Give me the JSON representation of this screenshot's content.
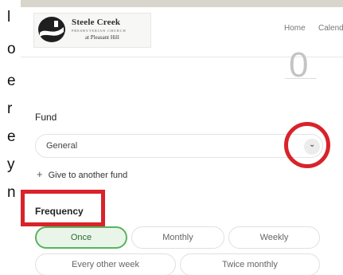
{
  "left_text": [
    "l",
    "o",
    "e",
    "r",
    "e",
    "y",
    "n"
  ],
  "header": {
    "logo": {
      "title": "Steele Creek",
      "subtitle": "PRESBYTERIAN CHURCH",
      "place": "at Pleasant Hill"
    },
    "nav": {
      "home": "Home",
      "calendar": "Calend"
    }
  },
  "amount": {
    "value": "0"
  },
  "fund": {
    "label": "Fund",
    "selected": "General",
    "add_label": "Give to another fund",
    "add_icon": "+"
  },
  "frequency": {
    "label": "Frequency",
    "options": [
      "Once",
      "Monthly",
      "Weekly",
      "Every other week",
      "Twice monthly"
    ],
    "selected": "Once"
  },
  "colors": {
    "annotation_red": "#d8232a",
    "selected_green": "#58b35f",
    "selected_bg": "#eaf5ea",
    "top_band": "#d8d5cd"
  }
}
